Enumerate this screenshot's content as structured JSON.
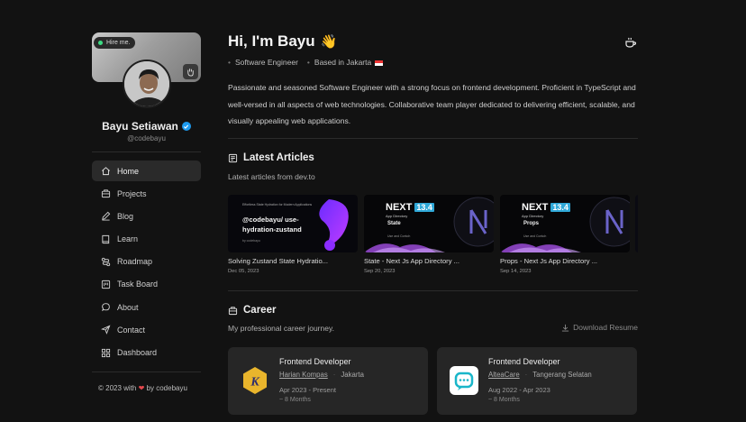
{
  "sidebar": {
    "hire_label": "Hire me.",
    "name": "Bayu Setiawan",
    "handle": "@codebayu",
    "nav": [
      {
        "label": "Home",
        "icon": "home-icon",
        "active": true
      },
      {
        "label": "Projects",
        "icon": "briefcase-icon"
      },
      {
        "label": "Blog",
        "icon": "pencil-icon"
      },
      {
        "label": "Learn",
        "icon": "book-icon"
      },
      {
        "label": "Roadmap",
        "icon": "roadmap-icon"
      },
      {
        "label": "Task Board",
        "icon": "board-icon"
      },
      {
        "label": "About",
        "icon": "chat-icon"
      },
      {
        "label": "Contact",
        "icon": "send-icon"
      },
      {
        "label": "Dashboard",
        "icon": "grid-icon"
      }
    ],
    "footer": {
      "prefix": "© 2023 with",
      "suffix": "by codebayu"
    }
  },
  "header": {
    "greeting": "Hi, I'm Bayu",
    "wave": "👋",
    "role": "Software Engineer",
    "location": "Based in Jakarta"
  },
  "bio": "Passionate and seasoned Software Engineer with a strong focus on frontend development. Proficient in TypeScript and well-versed in all aspects of web technologies. Collaborative team player dedicated to delivering efficient, scalable, and visually appealing web applications.",
  "articles": {
    "title": "Latest Articles",
    "subtitle": "Latest articles from dev.to",
    "items": [
      {
        "title": "Solving Zustand State Hydratio...",
        "date": "Dec 05, 2023",
        "thumb_small": "Effortless State Hydration for Modern Applications",
        "thumb_main": "@codebayu/ use-hydration-zustand",
        "thumb_footer": "by codebayu"
      },
      {
        "title": "State - Next Js App Directory ...",
        "date": "Sep 20, 2023",
        "thumb_next": "NEXT",
        "thumb_ver": "13.4",
        "thumb_sub": "App Directory",
        "thumb_topic": "State",
        "thumb_foot": "Use and Contoh"
      },
      {
        "title": "Props - Next Js App Directory ...",
        "date": "Sep 14, 2023",
        "thumb_next": "NEXT",
        "thumb_ver": "13.4",
        "thumb_sub": "App Directory",
        "thumb_topic": "Props",
        "thumb_foot": "Use and Contoh"
      }
    ]
  },
  "career": {
    "title": "Career",
    "subtitle": "My professional career journey.",
    "download_label": "Download Resume",
    "items": [
      {
        "role": "Frontend Developer",
        "company": "Harian Kompas",
        "location": "Jakarta",
        "period": "Apr 2023 - Present",
        "duration": "~ 8 Months",
        "logo_letter": "K"
      },
      {
        "role": "Frontend Developer",
        "company": "AlteaCare",
        "location": "Tangerang Selatan",
        "period": "Aug 2022 - Apr 2023",
        "duration": "~ 8 Months"
      }
    ]
  },
  "colors": {
    "background": "#121212",
    "card": "#262626",
    "accent_green": "#3ddc84",
    "verified_blue": "#1d9bf0"
  }
}
